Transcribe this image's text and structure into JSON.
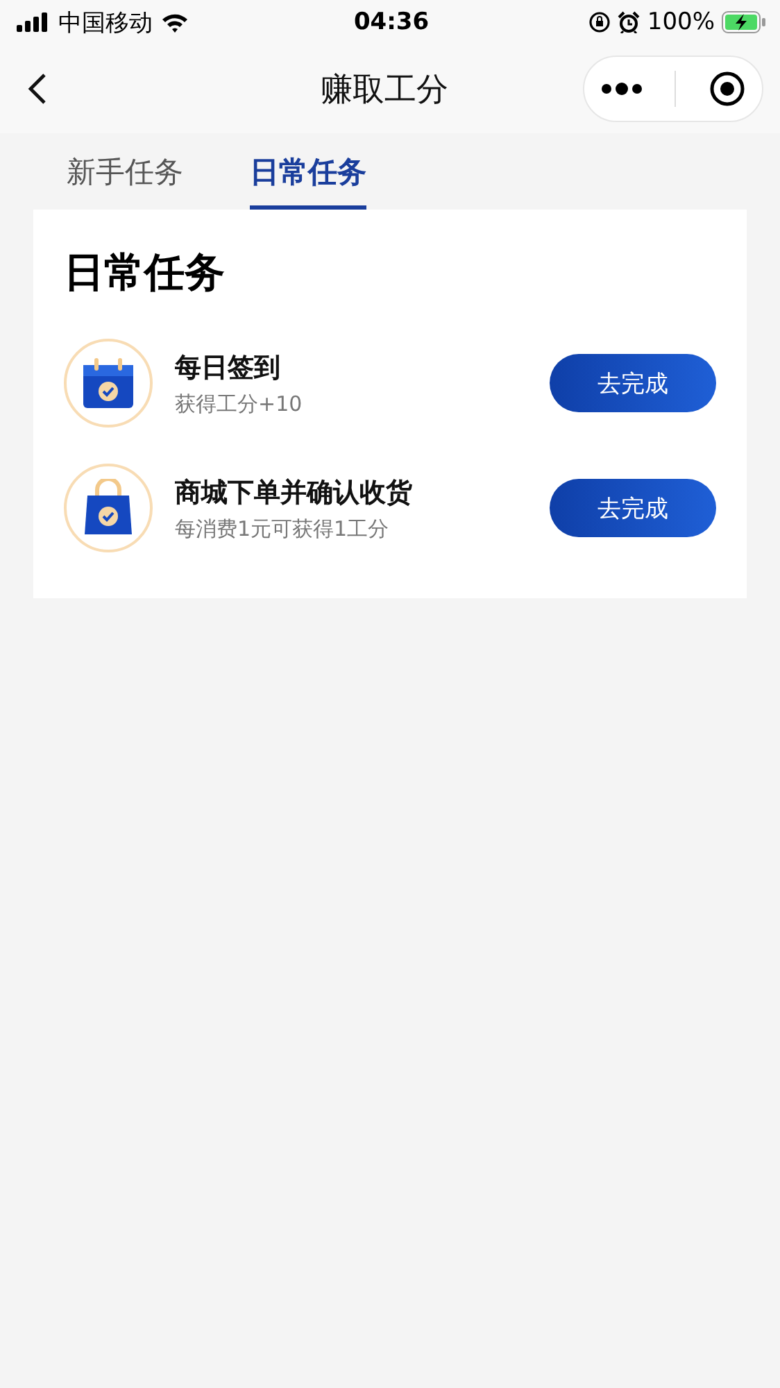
{
  "status_bar": {
    "carrier": "中国移动",
    "time": "04:36",
    "battery": "100%"
  },
  "nav_bar": {
    "title": "赚取工分"
  },
  "tabs": [
    {
      "label": "新手任务",
      "selected": false
    },
    {
      "label": "日常任务",
      "selected": true
    }
  ],
  "card": {
    "title": "日常任务",
    "tasks": [
      {
        "kind": "calendar",
        "title": "每日签到",
        "subtitle": "获得工分+10",
        "button": "去完成"
      },
      {
        "kind": "bag",
        "title": "商城下单并确认收货",
        "subtitle": "每消费1元可获得1工分",
        "button": "去完成"
      }
    ]
  }
}
